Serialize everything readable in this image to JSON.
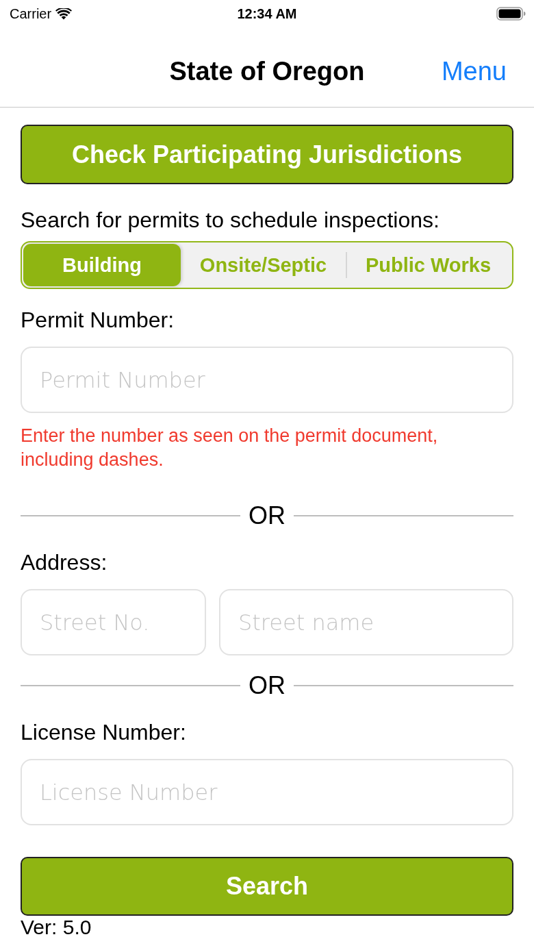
{
  "status_bar": {
    "carrier": "Carrier",
    "time": "12:34 AM"
  },
  "nav_bar": {
    "title": "State of Oregon",
    "menu": "Menu"
  },
  "jurisdictions_button": "Check Participating Jurisdictions",
  "search_prompt": "Search for permits to schedule inspections:",
  "permit_types": [
    {
      "label": "Building",
      "selected": true
    },
    {
      "label": "Onsite/Septic",
      "selected": false
    },
    {
      "label": "Public Works",
      "selected": false
    }
  ],
  "search_groups": [
    {
      "label": "Permit Number:",
      "fields": [
        {
          "placeholder": "Permit Number"
        }
      ],
      "hint": "Enter the number as seen on the permit document, including dashes."
    },
    {
      "label": "Address:",
      "fields": [
        {
          "placeholder": "Street No."
        },
        {
          "placeholder": "Street name"
        }
      ]
    },
    {
      "label": "License Number:",
      "fields": [
        {
          "placeholder": "License Number"
        }
      ]
    }
  ],
  "or_separators": [
    "OR",
    "OR"
  ],
  "search_button": "Search",
  "version": "Ver: 5.0"
}
